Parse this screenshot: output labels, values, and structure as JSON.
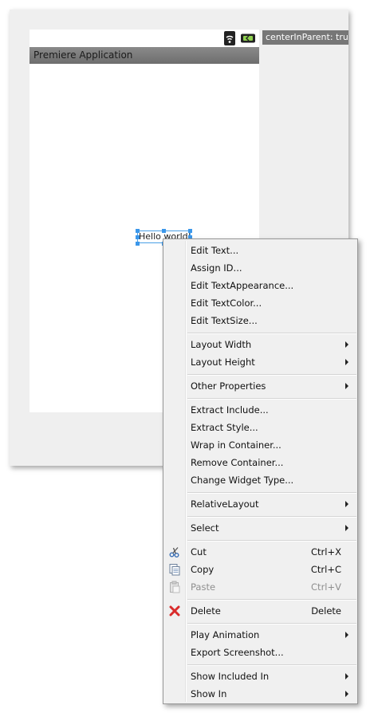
{
  "canvas": {
    "tooltip": "centerInParent: true",
    "app_title": "Premiere Application",
    "widget_text": "Hello world!"
  },
  "menu": {
    "edit_text": "Edit Text...",
    "assign_id": "Assign ID...",
    "edit_text_appearance": "Edit TextAppearance...",
    "edit_text_color": "Edit TextColor...",
    "edit_text_size": "Edit TextSize...",
    "layout_width": "Layout Width",
    "layout_height": "Layout Height",
    "other_properties": "Other Properties",
    "extract_include": "Extract Include...",
    "extract_style": "Extract Style...",
    "wrap_in_container": "Wrap in Container...",
    "remove_container": "Remove Container...",
    "change_widget_type": "Change Widget Type...",
    "relative_layout": "RelativeLayout",
    "select": "Select",
    "cut": "Cut",
    "cut_shortcut": "Ctrl+X",
    "copy": "Copy",
    "copy_shortcut": "Ctrl+C",
    "paste": "Paste",
    "paste_shortcut": "Ctrl+V",
    "delete": "Delete",
    "delete_shortcut": "Delete",
    "play_animation": "Play Animation",
    "export_screenshot": "Export Screenshot...",
    "show_included_in": "Show Included In",
    "show_in": "Show In"
  },
  "icons": {
    "status": [
      "wifi-icon",
      "battery-icon"
    ],
    "menu": [
      "cut-icon",
      "copy-icon",
      "paste-icon",
      "delete-icon"
    ]
  },
  "colors": {
    "selection": "#3b97ea",
    "title_bar": "#7c7c7c",
    "delete_icon": "#d92b2b"
  }
}
